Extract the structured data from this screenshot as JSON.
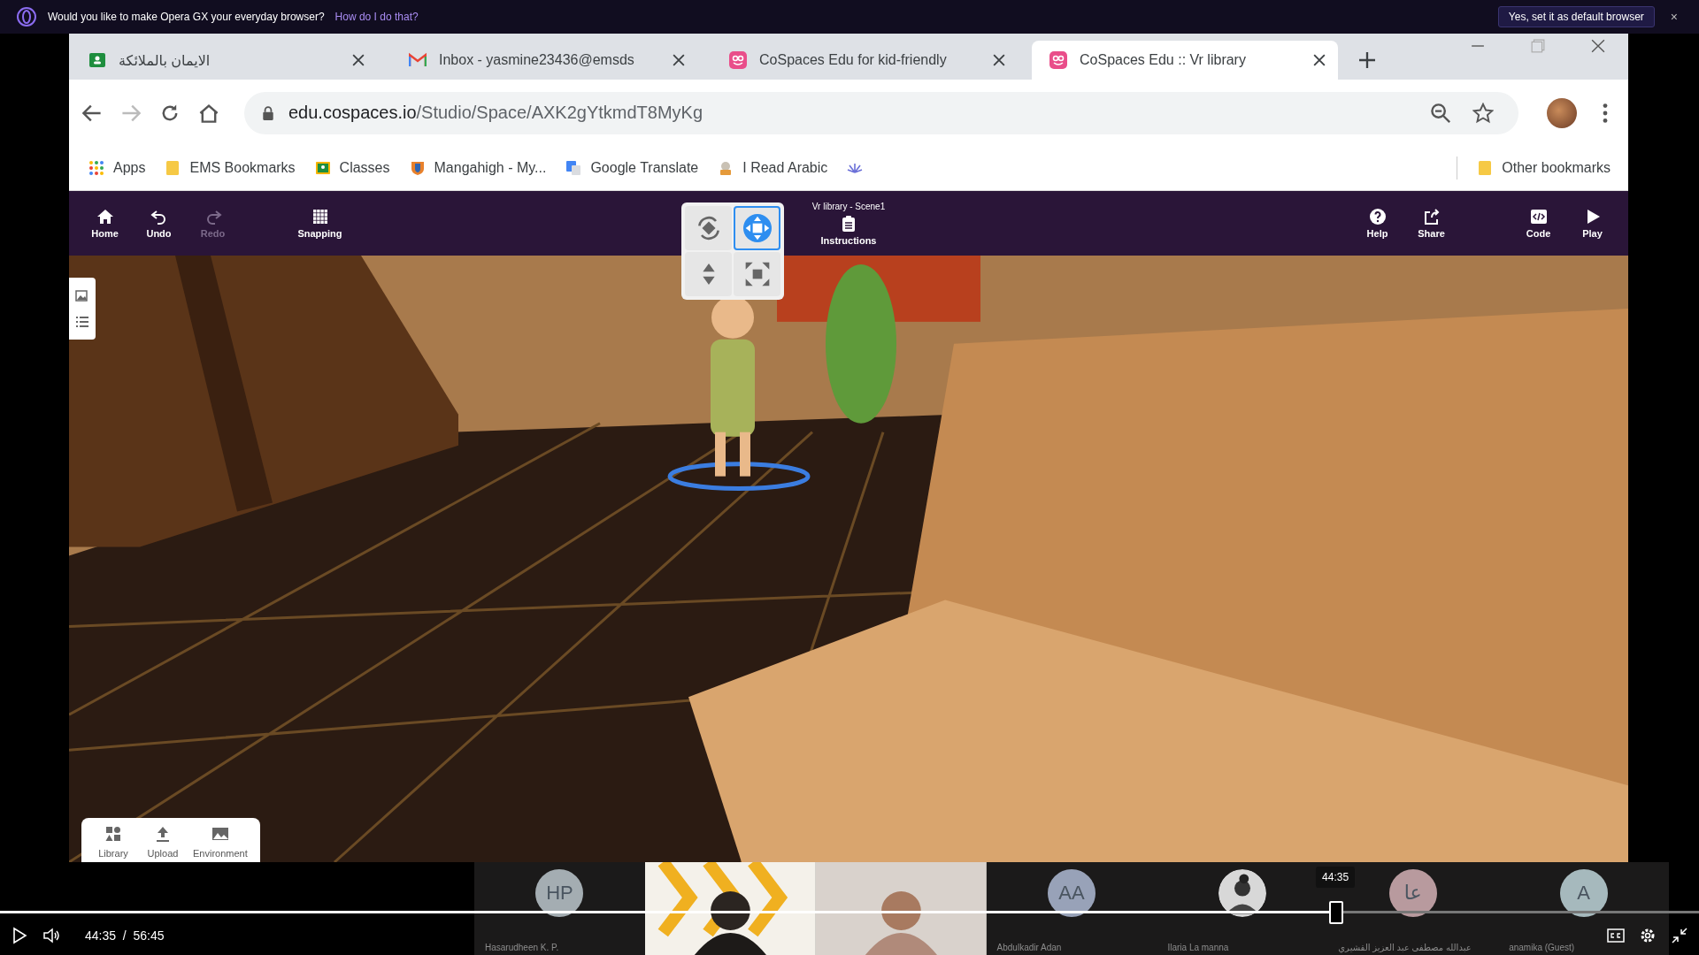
{
  "banner": {
    "message": "Would you like to make Opera GX your everyday browser?",
    "link": "How do I do that?",
    "button": "Yes, set it as default browser",
    "close": "×"
  },
  "browser": {
    "tabs": [
      {
        "title": "الايمان بالملائكة",
        "selected": false
      },
      {
        "title": "Inbox - yasmine23436@emsds",
        "selected": false
      },
      {
        "title": "CoSpaces Edu for kid-friendly",
        "selected": false
      },
      {
        "title": "CoSpaces Edu :: Vr library",
        "selected": true
      }
    ],
    "url": {
      "host": "edu.cospaces.io",
      "path": "/Studio/Space/AXK2gYtkmdT8MyKg"
    },
    "bookmarks": [
      "Apps",
      "EMS Bookmarks",
      "Classes",
      "Mangahigh - My...",
      "Google Translate",
      "I Read Arabic"
    ],
    "other_bookmarks": "Other bookmarks"
  },
  "editor": {
    "scene_title": "Vr library  - Scene1",
    "toolbar_left": [
      {
        "label": "Home",
        "disabled": false
      },
      {
        "label": "Undo",
        "disabled": false
      },
      {
        "label": "Redo",
        "disabled": true
      },
      {
        "label": "Snapping",
        "disabled": false
      }
    ],
    "toolbar_center": "Instructions",
    "toolbar_right": [
      "Help",
      "Share",
      "Code",
      "Play"
    ],
    "gizmo": [
      {
        "kind": "rotate",
        "selected": false
      },
      {
        "kind": "move",
        "selected": true
      },
      {
        "kind": "lift",
        "selected": false
      },
      {
        "kind": "scale",
        "selected": false
      }
    ],
    "bottom_panel": [
      "Library",
      "Upload",
      "Environment"
    ]
  },
  "participants": [
    {
      "kind": "initials",
      "initials": "HP",
      "color": "#a4adb2",
      "name": "Hasarudheen K. P."
    },
    {
      "kind": "video"
    },
    {
      "kind": "video"
    },
    {
      "kind": "initials",
      "initials": "AA",
      "color": "#98a2b8",
      "name": "Abdulkadir Adan"
    },
    {
      "name": "Ilaria  La manna"
    },
    {
      "kind": "initials",
      "initials": "عا",
      "color": "#b89a9e",
      "name": "عبدالله مصطفى عبد العزيز القشيري"
    },
    {
      "kind": "initials",
      "initials": "A",
      "color": "#a6b9bd",
      "name": "anamika (Guest)"
    }
  ],
  "player": {
    "progress": {
      "level": 0.786,
      "tooltip": "44:35"
    },
    "time": "44:35  /  56:45"
  }
}
